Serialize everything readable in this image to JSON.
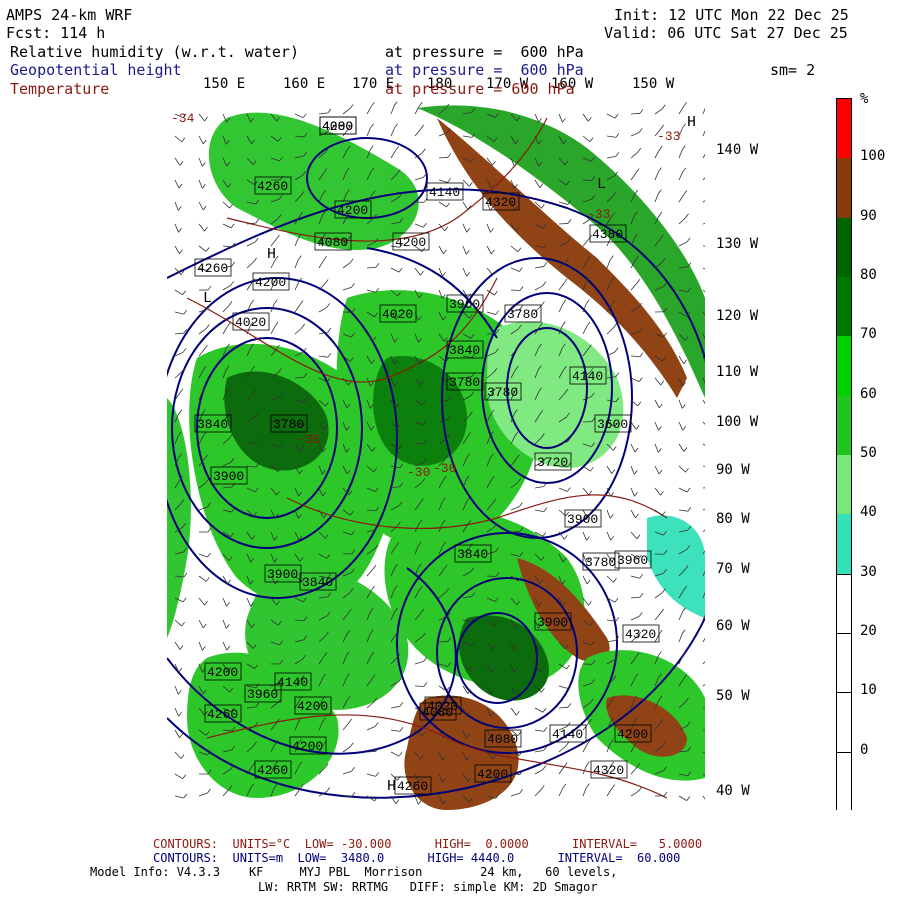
{
  "header": {
    "model": "AMPS 24-km WRF",
    "init": "Init: 12 UTC Mon 22 Dec 25",
    "fcst": "Fcst: 114 h",
    "valid": "Valid: 06 UTC Sat 27 Dec 25",
    "smoothing": "sm= 2"
  },
  "fields": [
    {
      "name": "Relative humidity (w.r.t. water)",
      "pressure": "at pressure =  600 hPa",
      "color": "#000000"
    },
    {
      "name": "Geopotential height",
      "pressure": "at pressure =  600 hPa",
      "color": "#1a1a8c"
    },
    {
      "name": "Temperature",
      "pressure": "at pressure = 600 hPa",
      "color": "#8b1a10"
    }
  ],
  "top_lon_labels": [
    "150 E",
    "160 E",
    "170 E",
    "180",
    "170 W",
    "160 W",
    "150 W"
  ],
  "right_lon_labels": [
    "140 W",
    "130 W",
    "120 W",
    "110 W",
    "100 W",
    "90 W",
    "80 W",
    "70 W",
    "60 W",
    "50 W",
    "40 W"
  ],
  "colorbar": {
    "unit": "%",
    "ticks": [
      "100",
      "90",
      "80",
      "70",
      "60",
      "50",
      "40",
      "30",
      "20",
      "10",
      "0"
    ],
    "colors": [
      {
        "from": 100,
        "to": 110,
        "hex": "#ff0000"
      },
      {
        "from": 90,
        "to": 100,
        "hex": "#8b3a0a"
      },
      {
        "from": 80,
        "to": 90,
        "hex": "#006400"
      },
      {
        "from": 70,
        "to": 80,
        "hex": "#007a00"
      },
      {
        "from": 60,
        "to": 70,
        "hex": "#00d200"
      },
      {
        "from": 50,
        "to": 60,
        "hex": "#22c51f"
      },
      {
        "from": 40,
        "to": 50,
        "hex": "#7be87b"
      },
      {
        "from": 30,
        "to": 40,
        "hex": "#33e0b8"
      },
      {
        "from": 20,
        "to": 30,
        "hex": "#ffffff"
      },
      {
        "from": 10,
        "to": 20,
        "hex": "#ffffff"
      },
      {
        "from": 0,
        "to": 10,
        "hex": "#ffffff"
      },
      {
        "from": -10,
        "to": 0,
        "hex": "#ffffff"
      }
    ]
  },
  "map_labels": {
    "height_labels": [
      "4200",
      "4260",
      "4140",
      "4320",
      "4080",
      "4200",
      "4200",
      "4260",
      "4380",
      "4200",
      "4020",
      "4020",
      "3960",
      "3780",
      "3840",
      "3780",
      "3600",
      "3840",
      "3720",
      "3780",
      "3900",
      "3900",
      "3840",
      "3960",
      "3840",
      "3900",
      "3780",
      "3900",
      "3960",
      "4140",
      "4020",
      "4200",
      "4260",
      "4200",
      "4080",
      "4080",
      "4260",
      "4200",
      "4320",
      "4200",
      "4140",
      "4200",
      "4320",
      "4260",
      "4140",
      "3780",
      "4080"
    ],
    "temp_labels": [
      "-34",
      "-33",
      "-30",
      "-35",
      "-33",
      "-30"
    ],
    "symbols": [
      "H",
      "L",
      "H",
      "L",
      "H"
    ]
  },
  "footer": {
    "contours_temp": "CONTOURS:  UNITS=°C  LOW= -30.000      HIGH=  0.0000      INTERVAL=   5.0000",
    "contours_height": "CONTOURS:  UNITS=m  LOW=  3480.0      HIGH= 4440.0      INTERVAL=  60.000",
    "model_info": "Model Info: V4.3.3    KF     MYJ PBL  Morrison        24 km,   60 levels,",
    "physics": "LW: RRTM SW: RRTMG   DIFF: simple KM: 2D Smagor"
  }
}
